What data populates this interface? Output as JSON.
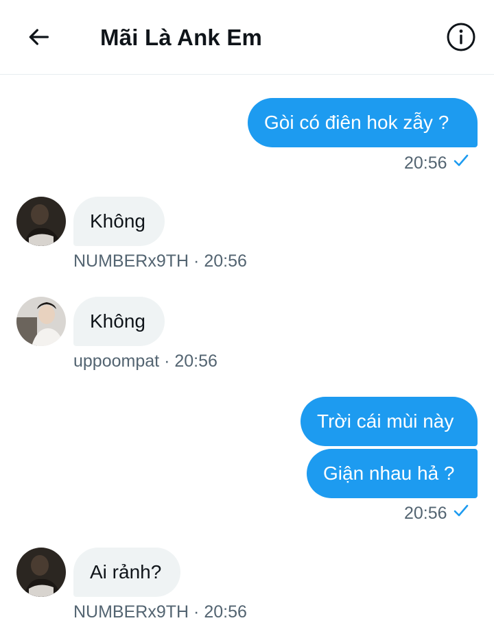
{
  "header": {
    "title": "Mãi Là Ank Em",
    "back_icon": "arrow-left-icon",
    "info_icon": "info-icon"
  },
  "colors": {
    "outgoing_bubble": "#1d9bf0",
    "incoming_bubble": "#eff3f4",
    "meta_text": "#536471",
    "check": "#1d9bf0"
  },
  "messages": {
    "m1": {
      "text": "Gòi có điên hok zẫy ?",
      "time": "20:56"
    },
    "m2": {
      "text": "Không",
      "sender": "NUMBERx9TH",
      "sep": "·",
      "time": "20:56"
    },
    "m3": {
      "text": "Không",
      "sender": "uppoompat",
      "sep": "·",
      "time": "20:56"
    },
    "m4": {
      "text": "Trời cái mùi này"
    },
    "m5": {
      "text": "Giận nhau hả ?",
      "time": "20:56"
    },
    "m6": {
      "text": "Ai rảnh?",
      "sender": "NUMBERx9TH",
      "sep": "·",
      "time": "20:56"
    }
  }
}
